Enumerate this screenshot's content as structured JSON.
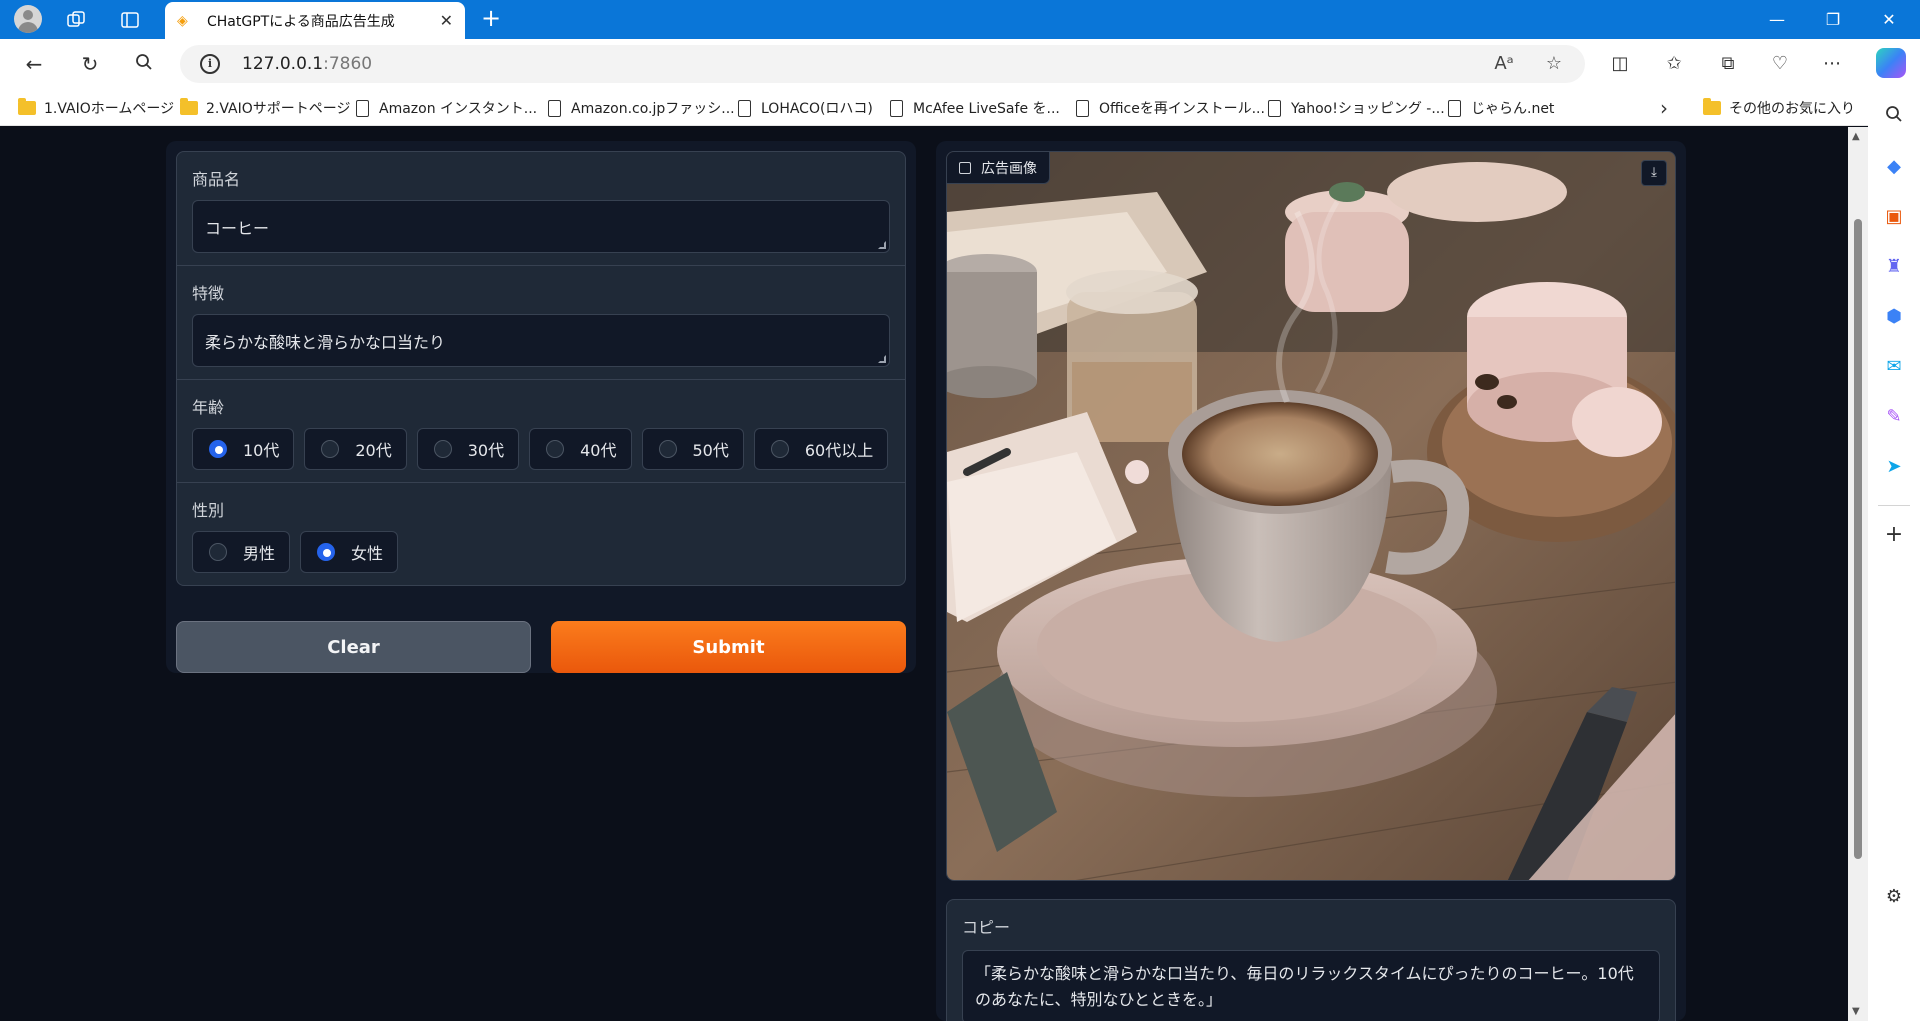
{
  "browser": {
    "tab_title": "CHatGPTによる商品広告生成",
    "url_host": "127.0.0.1",
    "url_port": ":7860",
    "bookmarks": [
      {
        "label": "1.VAIOホームページ",
        "type": "folder"
      },
      {
        "label": "2.VAIOサポートページ",
        "type": "folder"
      },
      {
        "label": "Amazon インスタント...",
        "type": "page"
      },
      {
        "label": "Amazon.co.jpファッシ...",
        "type": "page"
      },
      {
        "label": "LOHACO(ロハコ)",
        "type": "page"
      },
      {
        "label": "McAfee LiveSafe を...",
        "type": "page"
      },
      {
        "label": "Officeを再インストール...",
        "type": "page"
      },
      {
        "label": "Yahoo!ショッピング -...",
        "type": "page"
      },
      {
        "label": "じゃらん.net",
        "type": "page"
      }
    ],
    "other_favorites": "その他のお気に入り"
  },
  "form": {
    "product": {
      "label": "商品名",
      "value": "コーヒー"
    },
    "features": {
      "label": "特徴",
      "value": "柔らかな酸味と滑らかな口当たり"
    },
    "age": {
      "label": "年齢",
      "options": [
        "10代",
        "20代",
        "30代",
        "40代",
        "50代",
        "60代以上"
      ],
      "selected": "10代"
    },
    "gender": {
      "label": "性別",
      "options": [
        "男性",
        "女性"
      ],
      "selected": "女性"
    },
    "clear_label": "Clear",
    "submit_label": "Submit"
  },
  "output": {
    "image_label": "広告画像",
    "copy_label": "コピー",
    "copy_text": "「柔らかな酸味と滑らかな口当たり、毎日のリラックスタイムにぴったりのコーヒー。10代のあなたに、特別なひとときを。」"
  },
  "colors": {
    "accent_orange": "#ea580c",
    "radio_checked": "#2563eb",
    "page_bg": "#0b0f19",
    "panel_bg": "#1f2937",
    "titlebar": "#0a76d8"
  }
}
